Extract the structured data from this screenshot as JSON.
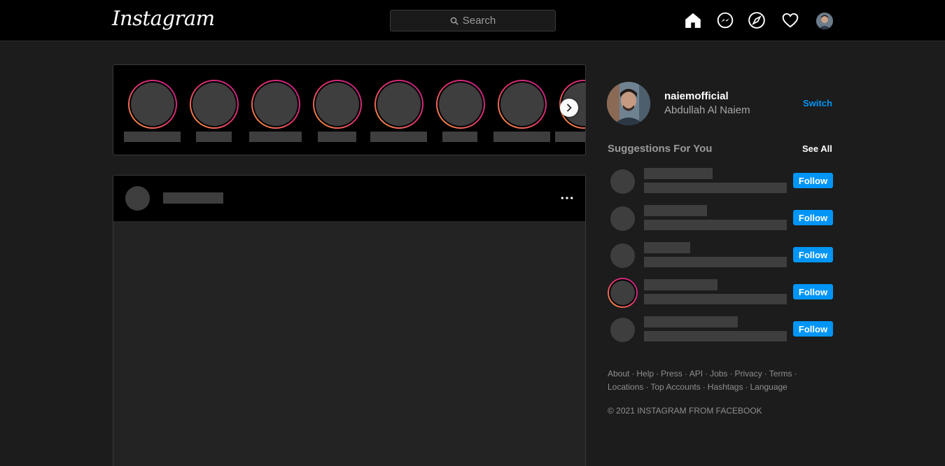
{
  "header": {
    "logo_text": "Instagram",
    "search_placeholder": "Search",
    "icons": [
      "home-icon",
      "messenger-icon",
      "explore-icon",
      "heart-icon",
      "profile-avatar"
    ]
  },
  "profile": {
    "username": "naiemofficial",
    "full_name": "Abdullah Al Naiem",
    "switch_label": "Switch"
  },
  "suggestions": {
    "title": "Suggestions For You",
    "see_all": "See All",
    "items": [
      {
        "follow_label": "Follow",
        "has_story": false
      },
      {
        "follow_label": "Follow",
        "has_story": false
      },
      {
        "follow_label": "Follow",
        "has_story": false
      },
      {
        "follow_label": "Follow",
        "has_story": true
      },
      {
        "follow_label": "Follow",
        "has_story": false
      }
    ]
  },
  "footer": {
    "links_row1": [
      "About",
      "Help",
      "Press",
      "API",
      "Jobs",
      "Privacy",
      "Terms"
    ],
    "links_row2": [
      "Locations",
      "Top Accounts",
      "Hashtags",
      "Language"
    ],
    "copyright": "© 2021 INSTAGRAM FROM FACEBOOK"
  },
  "colors": {
    "accent": "#0095f6",
    "background": "#1c1c1c",
    "header_bg": "#000000",
    "skeleton": "#3e3e3e"
  }
}
